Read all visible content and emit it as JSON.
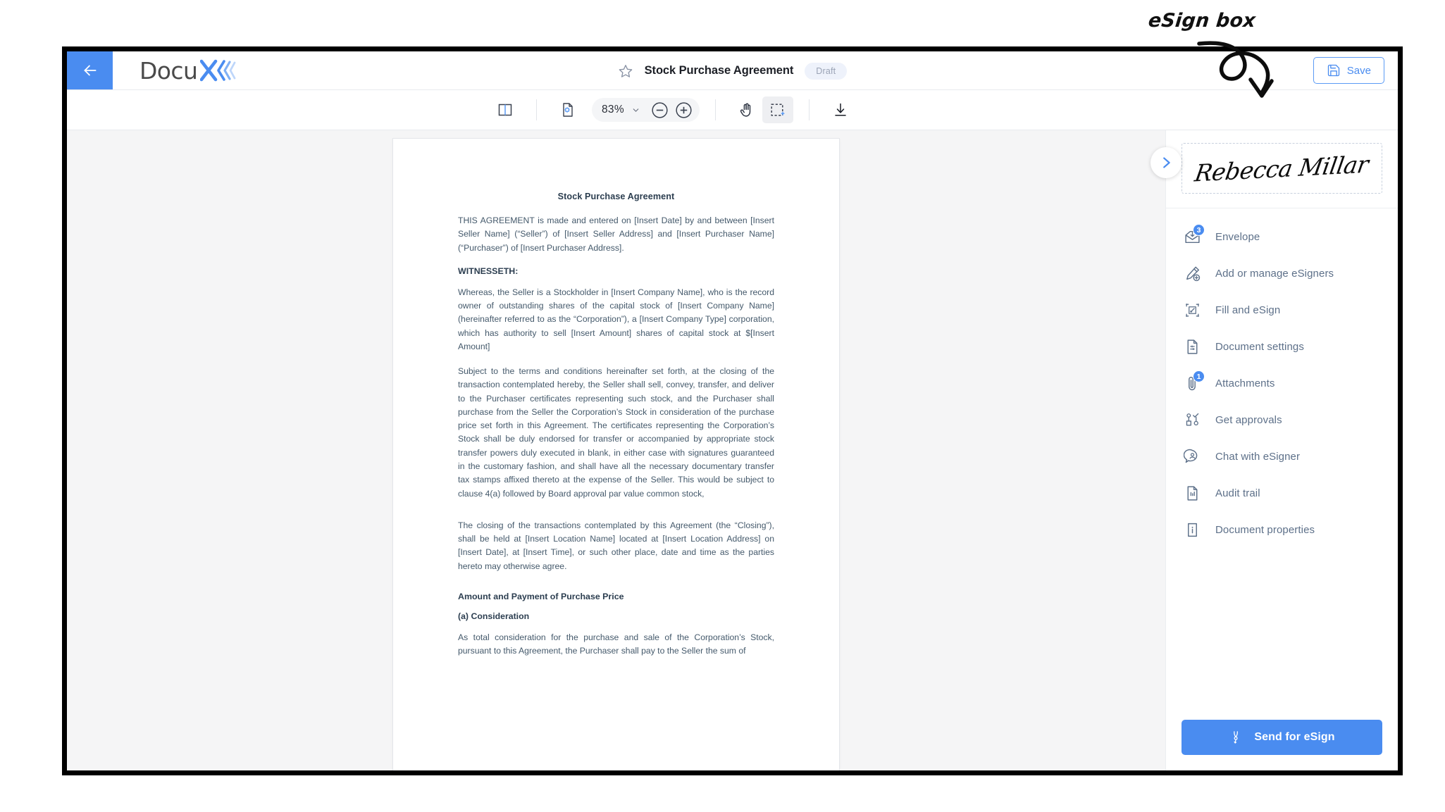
{
  "annotation": {
    "label": "eSign box",
    "arrow": "curly-arrow-pointing-to-signature-box"
  },
  "header": {
    "back_icon": "arrow-left-icon",
    "brand_name": "Docu",
    "brand_mark": "X",
    "star_icon": "star-outline-icon",
    "title": "Stock Purchase Agreement",
    "status": "Draft",
    "save_label": "Save",
    "save_icon": "floppy-disk-icon"
  },
  "toolbar": {
    "panel_toggle_icon": "split-panel-icon",
    "page_settings_icon": "page-gear-icon",
    "zoom_level": "83%",
    "zoom_caret_icon": "chevron-down-icon",
    "zoom_out_icon": "minus-circle-icon",
    "zoom_in_icon": "plus-circle-icon",
    "hand_icon": "hand-tool-icon",
    "select_icon": "marquee-select-icon",
    "download_icon": "download-icon",
    "active_tool": "marquee-select"
  },
  "document": {
    "title": "Stock Purchase Agreement",
    "paragraphs": [
      "THIS AGREEMENT is made and entered on [Insert Date] by and between [Insert Seller Name] (“Seller”) of [Insert Seller Address] and [Insert Purchaser Name] (“Purchaser”) of [Insert Purchaser Address].",
      "WITNESSETH:",
      "Whereas, the Seller is a Stockholder in [Insert Company Name], who is the record owner of outstanding shares of the capital stock of [Insert Company Name] (hereinafter referred to as the “Corporation”), a [Insert Company Type] corporation, which has authority to sell [Insert Amount] shares of capital stock at $[Insert Amount]",
      "Subject to the terms and conditions hereinafter set forth, at the closing of the transaction contemplated hereby, the Seller shall sell, convey, transfer, and deliver to the Purchaser certificates representing such stock, and the Purchaser shall purchase from the Seller the Corporation’s Stock in consideration of the purchase price set forth in this Agreement. The certificates representing the Corporation’s Stock shall be duly endorsed for transfer or accompanied by appropriate stock transfer powers duly executed in blank, in either case with signatures guaranteed in the customary fashion, and shall have all the necessary documentary transfer tax stamps affixed thereto at the expense of the Seller. This would be subject to clause 4(a) followed by Board approval  par value common stock,",
      "The closing of the transactions contemplated by this Agreement (the “Closing”), shall be held at [Insert Location Name] located at [Insert Location Address] on [Insert Date], at [Insert Time], or such other place, date and time as the parties hereto may otherwise agree.",
      "Amount and Payment of Purchase Price",
      "(a) Consideration",
      "As total consideration for the purchase and sale of the Corporation’s Stock, pursuant to this Agreement, the Purchaser shall pay to the Seller the sum of"
    ]
  },
  "sidebar": {
    "collapse_icon": "chevron-right-icon",
    "signature": "Rebecca Millar",
    "items": [
      {
        "label": "Envelope",
        "icon": "envelope-icon",
        "badge": "3"
      },
      {
        "label": "Add or manage eSigners",
        "icon": "pen-add-icon",
        "badge": ""
      },
      {
        "label": "Fill and eSign",
        "icon": "fill-sign-icon",
        "badge": ""
      },
      {
        "label": "Document settings",
        "icon": "document-settings-icon",
        "badge": ""
      },
      {
        "label": "Attachments",
        "icon": "paperclip-icon",
        "badge": "1"
      },
      {
        "label": "Get approvals",
        "icon": "approvals-icon",
        "badge": ""
      },
      {
        "label": "Chat with eSigner",
        "icon": "chat-user-icon",
        "badge": ""
      },
      {
        "label": "Audit trail",
        "icon": "audit-trail-icon",
        "badge": ""
      },
      {
        "label": "Document properties",
        "icon": "info-document-icon",
        "badge": ""
      }
    ],
    "send_label": "Send for eSign",
    "send_icon": "pen-nib-icon"
  },
  "colors": {
    "accent": "#4a8cf0",
    "text_muted": "#5d7089",
    "doc_text": "#44596b",
    "frame": "#000000"
  }
}
